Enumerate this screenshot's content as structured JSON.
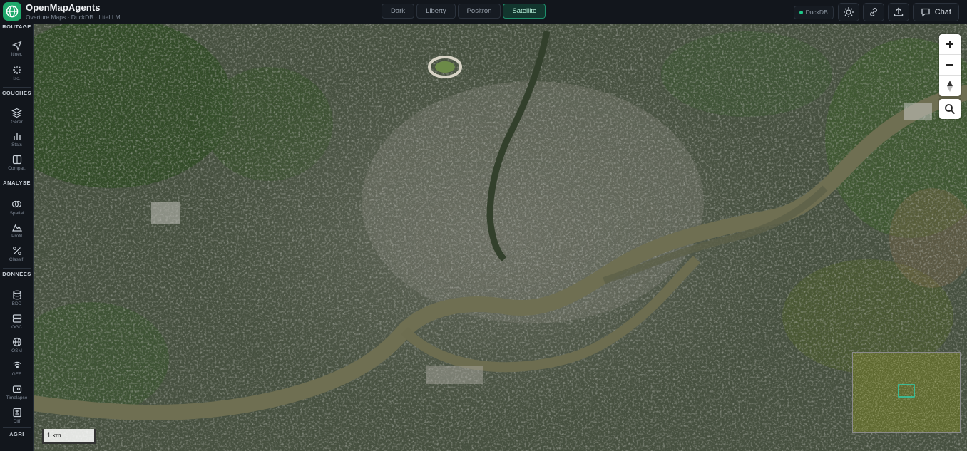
{
  "app": {
    "title": "OpenMapAgents",
    "subtitle": "Overture Maps · DuckDB · LiteLLM"
  },
  "map_styles": [
    {
      "label": "Dark",
      "active": false
    },
    {
      "label": "Liberty",
      "active": false
    },
    {
      "label": "Positron",
      "active": false
    },
    {
      "label": "Satellite",
      "active": true
    }
  ],
  "toolbar": {
    "db_label": "DuckDB",
    "chat_label": "Chat"
  },
  "sidebar": {
    "sections": [
      {
        "label": "ROUTAGE",
        "items": [
          {
            "label": "Itinér.",
            "icon": "navigation-icon"
          },
          {
            "label": "Iso.",
            "icon": "isochrone-icon"
          }
        ]
      },
      {
        "label": "COUCHES",
        "items": [
          {
            "label": "Gérer",
            "icon": "layers-icon"
          },
          {
            "label": "Stats",
            "icon": "bar-chart-icon"
          },
          {
            "label": "Compar.",
            "icon": "compare-icon"
          }
        ]
      },
      {
        "label": "ANALYSE",
        "items": [
          {
            "label": "Spatial",
            "icon": "spatial-icon"
          },
          {
            "label": "Profil",
            "icon": "profile-icon"
          },
          {
            "label": "Classif.",
            "icon": "percent-icon"
          }
        ]
      },
      {
        "label": "DONNÉES",
        "items": [
          {
            "label": "BDD",
            "icon": "database-icon"
          },
          {
            "label": "OGC",
            "icon": "server-icon"
          },
          {
            "label": "OSM",
            "icon": "globe-icon"
          },
          {
            "label": "GEE",
            "icon": "satellite-icon"
          },
          {
            "label": "Timelapse",
            "icon": "timelapse-icon"
          },
          {
            "label": "Diff",
            "icon": "diff-icon"
          }
        ]
      },
      {
        "label": "AGRI",
        "items": []
      }
    ]
  },
  "map": {
    "scale_label": "1 km",
    "colors": {
      "river": "#6f6f52",
      "urban": "#6b6e64",
      "vegetation": "#2f4a22",
      "accent": "#1fa86b"
    }
  }
}
